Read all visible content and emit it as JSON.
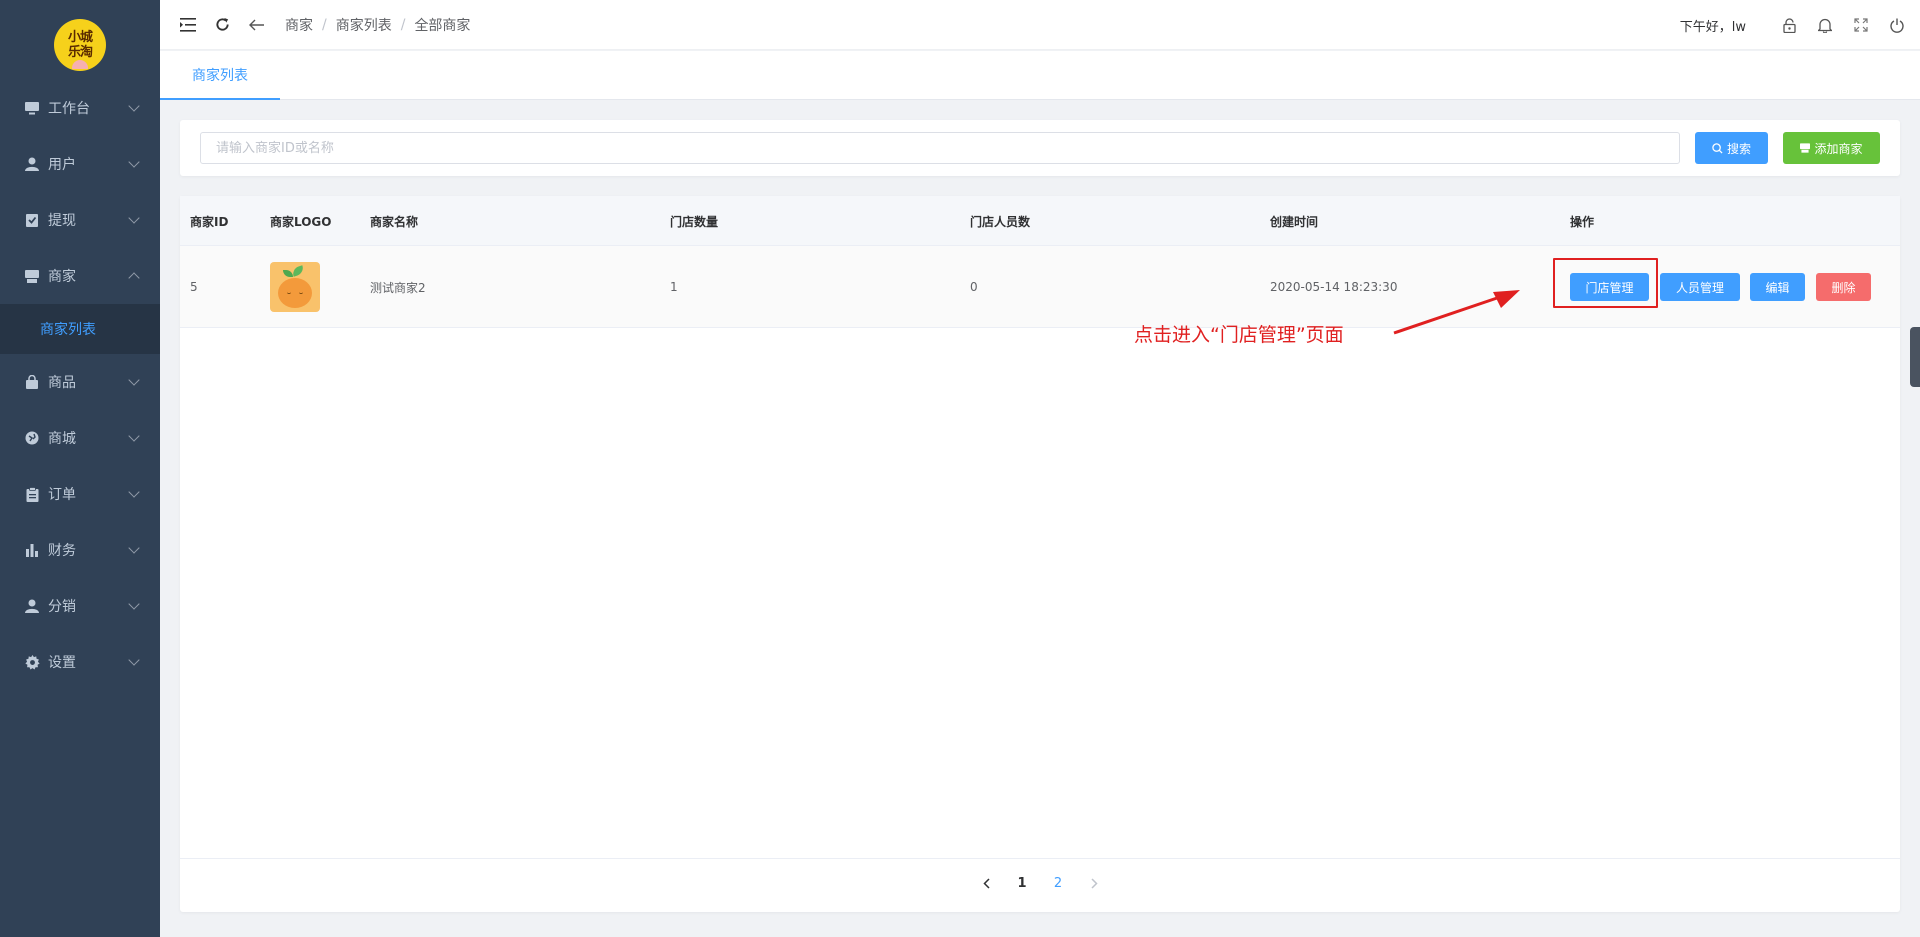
{
  "logo": {
    "line1": "小城",
    "line2": "乐淘"
  },
  "sidebar": {
    "items": [
      {
        "label": "工作台",
        "icon": "monitor-icon"
      },
      {
        "label": "用户",
        "icon": "user-icon"
      },
      {
        "label": "提现",
        "icon": "checklist-icon"
      },
      {
        "label": "商家",
        "icon": "store-icon",
        "expanded": true,
        "children": [
          {
            "label": "商家列表",
            "active": true
          }
        ]
      },
      {
        "label": "商品",
        "icon": "bag-icon"
      },
      {
        "label": "商城",
        "icon": "globe-icon"
      },
      {
        "label": "订单",
        "icon": "clipboard-icon"
      },
      {
        "label": "财务",
        "icon": "bar-chart-icon"
      },
      {
        "label": "分销",
        "icon": "user-icon"
      },
      {
        "label": "设置",
        "icon": "gear-icon"
      }
    ]
  },
  "header": {
    "breadcrumb": [
      "商家",
      "商家列表",
      "全部商家"
    ],
    "separator": "/",
    "greeting": "下午好，lw"
  },
  "tabs": [
    {
      "label": "商家列表",
      "active": true
    }
  ],
  "search": {
    "placeholder": "请输入商家ID或名称",
    "value": "",
    "search_label": "搜索",
    "add_label": "添加商家"
  },
  "table": {
    "columns": [
      "商家ID",
      "商家LOGO",
      "商家名称",
      "门店数量",
      "门店人员数",
      "创建时间",
      "操作"
    ],
    "rows": [
      {
        "id": "5",
        "name": "测试商家2",
        "store_count": "1",
        "staff_count": "0",
        "created_at": "2020-05-14 18:23:30"
      }
    ],
    "actions": {
      "store": "门店管理",
      "staff": "人员管理",
      "edit": "编辑",
      "delete": "删除"
    }
  },
  "annotation": {
    "text": "点击进入“门店管理”页面",
    "color": "#e02020"
  },
  "pagination": {
    "pages": [
      "1",
      "2"
    ],
    "current": "1"
  },
  "colors": {
    "primary": "#409eff",
    "success": "#67c23a",
    "danger": "#f56c6c",
    "sidebar": "#304156"
  }
}
